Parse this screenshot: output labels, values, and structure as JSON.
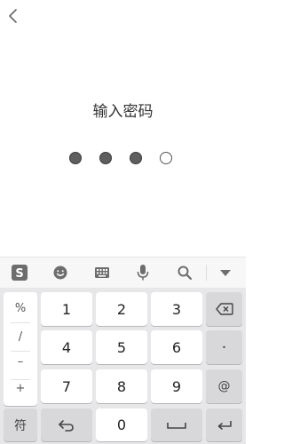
{
  "page": {
    "title": "输入密码"
  },
  "passcode": {
    "length": 4,
    "entered": 3
  },
  "keyboard": {
    "symbols": [
      "%",
      "/",
      "–",
      "+"
    ],
    "rows": [
      [
        "1",
        "2",
        "3"
      ],
      [
        "4",
        "5",
        "6"
      ],
      [
        "7",
        "8",
        "9"
      ]
    ],
    "side": {
      "dot": "·",
      "at": "@"
    },
    "bottom": {
      "symbol_label": "符",
      "zero": "0"
    }
  },
  "toolbar_icons": [
    "sogou-logo-icon",
    "emoji-icon",
    "keyboard-icon",
    "microphone-icon",
    "search-icon",
    "collapse-icon"
  ]
}
